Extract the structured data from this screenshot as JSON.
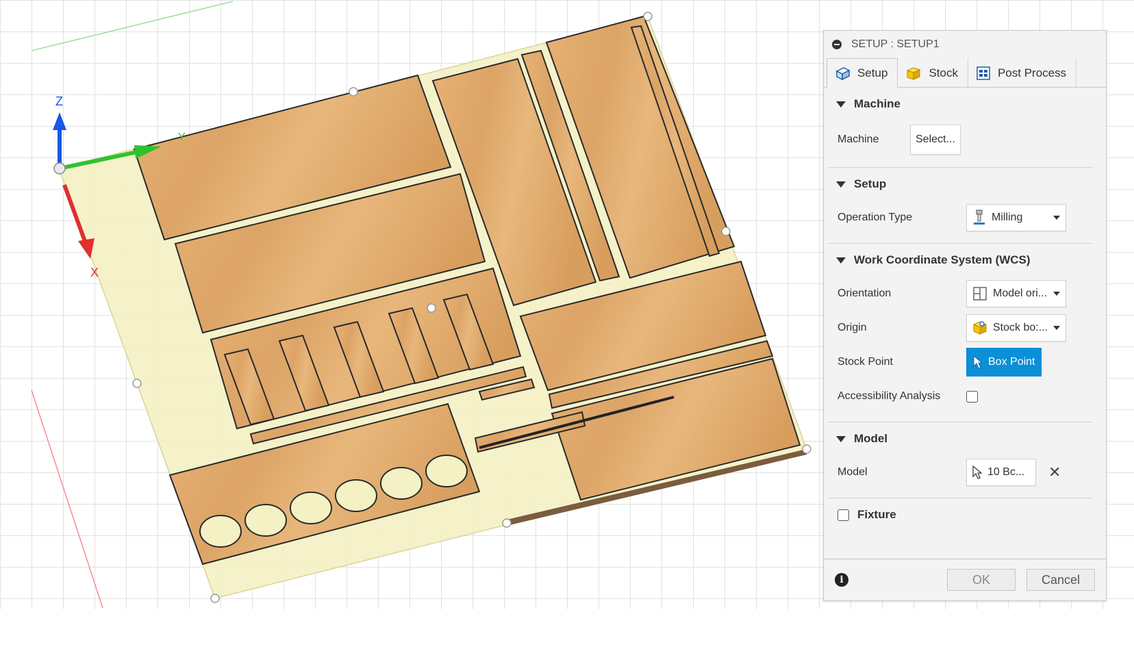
{
  "axes": {
    "z": "Z",
    "y": "Y",
    "x": "X"
  },
  "panel": {
    "title": "SETUP : SETUP1",
    "tabs": [
      {
        "label": "Setup",
        "icon": "setup-icon",
        "active": true
      },
      {
        "label": "Stock",
        "icon": "stock-cube-icon",
        "active": false
      },
      {
        "label": "Post Process",
        "icon": "post-process-icon",
        "active": false
      }
    ],
    "machine": {
      "header": "Machine",
      "label": "Machine",
      "button": "Select..."
    },
    "setup": {
      "header": "Setup",
      "operation_type_label": "Operation Type",
      "operation_type_value": "Milling"
    },
    "wcs": {
      "header": "Work Coordinate System (WCS)",
      "orientation_label": "Orientation",
      "orientation_value": "Model ori...",
      "origin_label": "Origin",
      "origin_value": "Stock bo:...",
      "stock_point_label": "Stock Point",
      "stock_point_value": "Box Point",
      "accessibility_label": "Accessibility Analysis",
      "accessibility_checked": false
    },
    "model": {
      "header": "Model",
      "label": "Model",
      "value": "10 Bc..."
    },
    "fixture": {
      "label": "Fixture",
      "checked": false
    },
    "footer": {
      "ok": "OK",
      "cancel": "Cancel"
    }
  },
  "colors": {
    "accent_blue": "#0b8fd6",
    "wood": "#e3ad6c",
    "stock_yellow": "#f4f1c4",
    "axis_x": "#e03030",
    "axis_y": "#2fc22f",
    "axis_z": "#1a56e6"
  }
}
